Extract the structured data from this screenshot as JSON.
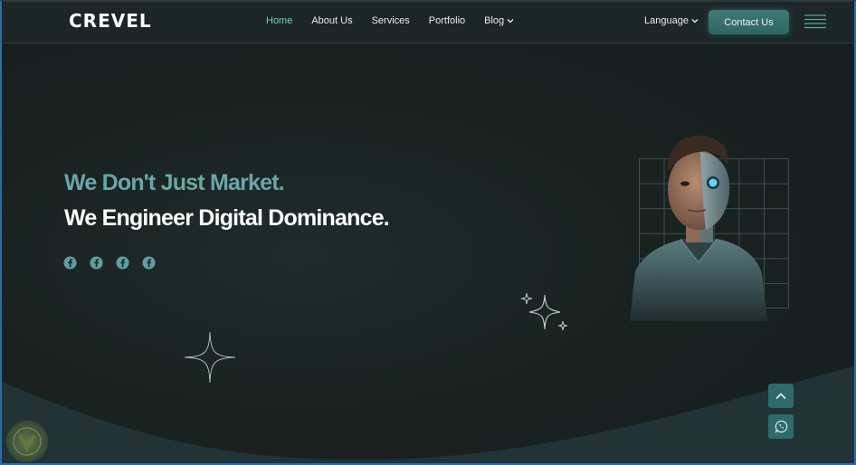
{
  "brand": {
    "logo_text": "CREVEL"
  },
  "nav": {
    "items": [
      {
        "label": "Home",
        "active": true
      },
      {
        "label": "About Us"
      },
      {
        "label": "Services"
      },
      {
        "label": "Portfolio"
      },
      {
        "label": "Blog",
        "dropdown": true
      }
    ],
    "language_label": "Language",
    "contact_label": "Contact Us"
  },
  "hero": {
    "line1": "We Don't Just Market.",
    "line2": "We Engineer Digital Dominance."
  },
  "socials": [
    "facebook-icon",
    "facebook-icon",
    "facebook-icon",
    "facebook-icon"
  ],
  "colors": {
    "accent": "#6fd3b2",
    "hero_line1": "#6aa7a8",
    "button": "#2f6a6b",
    "background": "#1b2425"
  }
}
